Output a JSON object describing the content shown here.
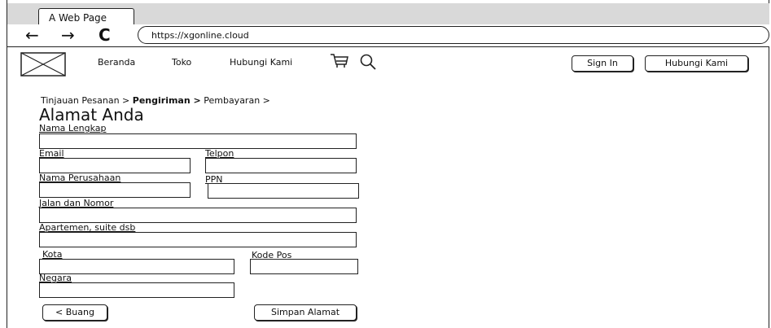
{
  "browser": {
    "tab_title": "A Web Page",
    "back_icon": "arrow-left-icon",
    "forward_icon": "arrow-right-icon",
    "reload_icon": "reload-icon",
    "url": "https://xgonline.cloud"
  },
  "header": {
    "nav": [
      "Beranda",
      "Toko",
      "Hubungi Kami"
    ],
    "cart_icon": "cart-icon",
    "search_icon": "search-icon",
    "sign_in": "Sign In",
    "contact": "Hubungi Kami"
  },
  "breadcrumb": {
    "step1": "Tinjauan Pesanan >",
    "step2": "Pengiriman >",
    "step3": "Pembayaran >"
  },
  "form": {
    "title": "Alamat Anda",
    "full_name": "Nama Lengkap",
    "email": "Email",
    "phone": "Telpon",
    "company": "Nama Perusahaan",
    "vat": "PPN",
    "street": "Jalan dan Nomor",
    "apartment": "Apartemen, suite dsb",
    "city": "Kota",
    "postal": "Kode Pos",
    "country": "Negara",
    "cancel": "< Buang",
    "save": "Simpan Alamat"
  }
}
